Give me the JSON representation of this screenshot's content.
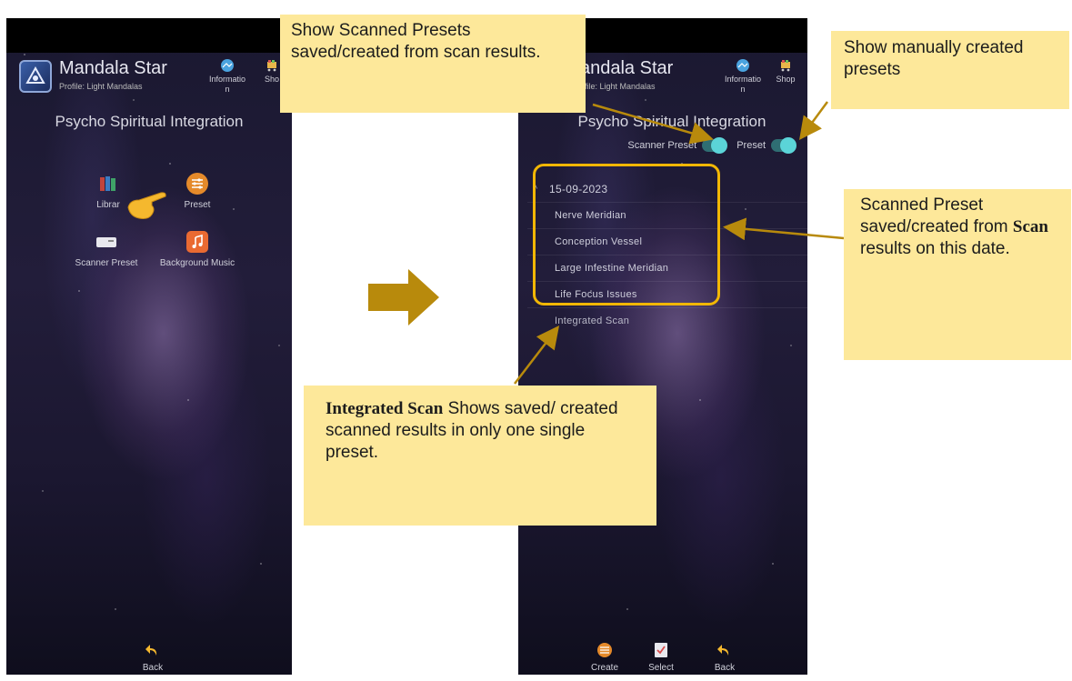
{
  "left_screen": {
    "app_title": "Mandala Star",
    "profile": "Profile: Light Mandalas",
    "header_buttons": [
      {
        "label": "Informatio n",
        "icon": "info-globe-icon"
      },
      {
        "label": "Sho",
        "icon": "shop-cart-icon"
      }
    ],
    "section_title": "Psycho Spiritual Integration",
    "menu": [
      {
        "label": "Librar",
        "icon": "books-icon"
      },
      {
        "label": "Preset",
        "icon": "sliders-icon"
      },
      {
        "label": "Scanner Preset",
        "icon": "scanner-icon"
      },
      {
        "label": "Background Music",
        "icon": "music-note-icon"
      }
    ],
    "back_label": "Back"
  },
  "right_screen": {
    "app_title": "andala Star",
    "profile": "ofile: Light Mandalas",
    "header_buttons": [
      {
        "label": "Informatio n",
        "icon": "info-globe-icon"
      },
      {
        "label": "Shop",
        "icon": "shop-cart-icon"
      }
    ],
    "section_title": "Psycho Spiritual Integration",
    "toggles": [
      {
        "label": "Scanner Preset",
        "on": true
      },
      {
        "label": "Preset",
        "on": true
      }
    ],
    "list": {
      "date": "15-09-2023",
      "items": [
        "Nerve Meridian",
        "Conception Vessel",
        "Large Infestine Meridian",
        "Life Focus Issues"
      ],
      "extra": "Integrated Scan"
    },
    "bottom_buttons": [
      {
        "label": "Create",
        "icon": "create-icon"
      },
      {
        "label": "Select",
        "icon": "select-icon"
      },
      {
        "label": "Back",
        "icon": "back-arrow-icon"
      }
    ]
  },
  "annotations": {
    "scanned_presets": "Show Scanned Presets saved/created from scan results.",
    "manual_presets": "Show manually created presets",
    "scanned_preset_date": {
      "pre": "Scanned Preset saved/created from ",
      "bold": "Scan",
      "post": " results on this date."
    },
    "integrated_scan": {
      "bold": "Integrated Scan",
      "rest": " Shows saved/ created scanned results in only one single preset."
    }
  },
  "colors": {
    "note_bg": "#fde89a",
    "highlight": "#f2b705",
    "arrow": "#b88a0c",
    "toggle": "#5bd4d8"
  }
}
